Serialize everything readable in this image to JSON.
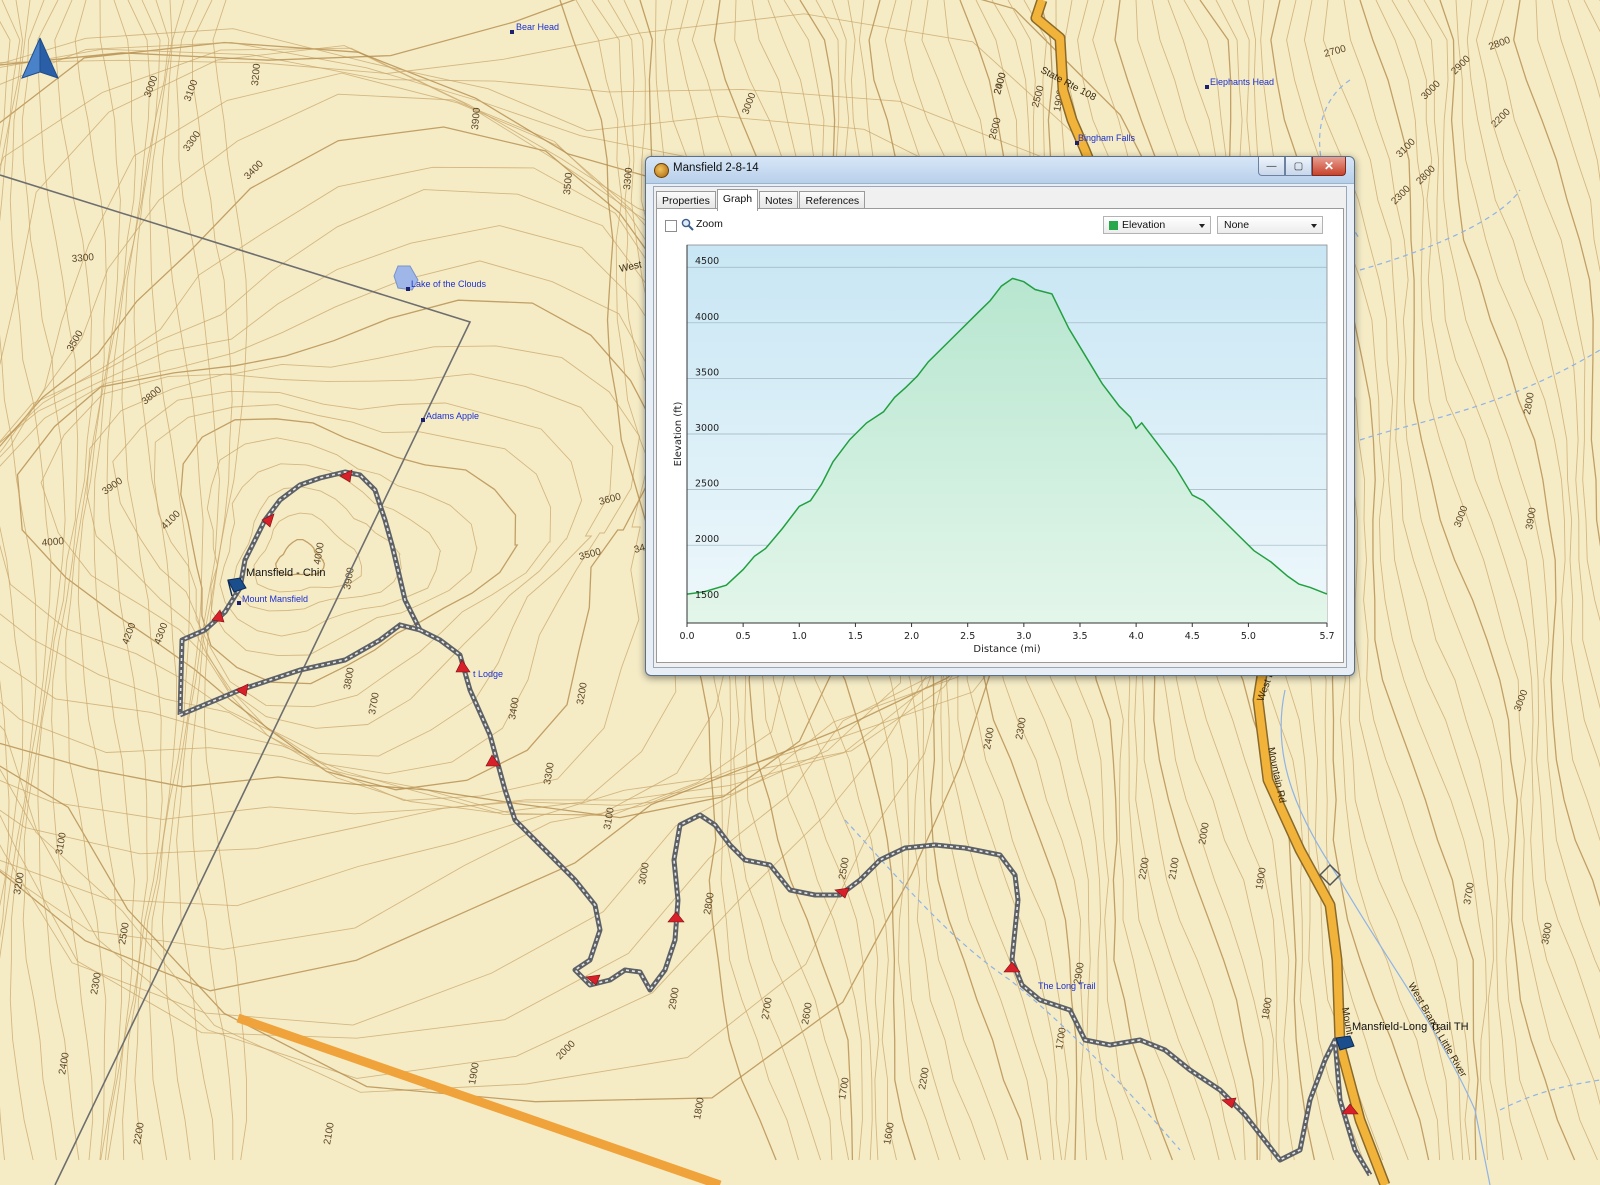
{
  "map": {
    "north_arrow_icon": "north-arrow-icon",
    "elevation_labels": [
      "3000",
      "3100",
      "3200",
      "3300",
      "3400",
      "3900",
      "3000",
      "3500",
      "3300",
      "3300",
      "3500",
      "3800",
      "3900",
      "4000",
      "4100",
      "4000",
      "4300",
      "4200",
      "3900",
      "3800",
      "3700",
      "3600",
      "3500",
      "3400",
      "3400",
      "3300",
      "3200",
      "3100",
      "3000",
      "2900",
      "2800",
      "2700",
      "2600",
      "2500",
      "2400",
      "2300",
      "2200",
      "2100",
      "2000",
      "1900",
      "1800",
      "1700",
      "3700",
      "3800",
      "3900",
      "3000",
      "2800",
      "2900",
      "3000",
      "3100",
      "3200",
      "2500",
      "2300",
      "2400",
      "2200",
      "2100",
      "2000",
      "1900",
      "1800",
      "1700",
      "1600",
      "2200",
      "2400",
      "2500",
      "2600",
      "2700",
      "2800",
      "2900",
      "3000",
      "3100",
      "2800",
      "2300",
      "2200",
      "2000",
      "1900"
    ],
    "poi": {
      "bear_head": "Bear Head",
      "elephants_head": "Elephants Head",
      "bingham_falls": "Bingham Falls",
      "lake_of_the_clouds": "Lake of the Clouds",
      "adams_apple": "Adams Apple",
      "mount_mansfield": "Mount Mansfield",
      "lodge": "t Lodge",
      "long_trail": "The Long Trail"
    },
    "roads": {
      "state_rte_108": "State Rte 108",
      "mountain_rd": "Mountain Rd",
      "west_branch": "West Branch Little River",
      "west": "West",
      "west_b": "West B",
      "mount": "Mount"
    },
    "waypoints": {
      "chin": "Mansfield - Chin",
      "trailhead": "Mansfield-Long Trail TH"
    },
    "colors": {
      "background": "#f5ecc6",
      "contour": "#c9a56a",
      "highway": "#f2b33a",
      "track": "#6f7378",
      "arrow": "#d8202a",
      "water": "#8fb3e6"
    }
  },
  "window": {
    "title": "Mansfield 2-8-14",
    "buttons": {
      "minimize": "—",
      "maximize": "▢",
      "close": "✕"
    },
    "tabs": [
      "Properties",
      "Graph",
      "Notes",
      "References"
    ],
    "active_tab": "Graph",
    "toolbar": {
      "zoom_label": "Zoom",
      "primary_select": "Elevation",
      "secondary_select": "None"
    }
  },
  "chart_data": {
    "type": "area",
    "title": "",
    "xlabel": "Distance  (mi)",
    "ylabel": "Elevation (ft)",
    "xlim": [
      0.0,
      5.7
    ],
    "ylim": [
      1300,
      4700
    ],
    "x_ticks": [
      "0.0",
      "0.5",
      "1.0",
      "1.5",
      "2.0",
      "2.5",
      "3.0",
      "3.5",
      "4.0",
      "4.5",
      "5.0",
      "5.7"
    ],
    "x_tick_values": [
      0.0,
      0.5,
      1.0,
      1.5,
      2.0,
      2.5,
      3.0,
      3.5,
      4.0,
      4.5,
      5.0,
      5.7
    ],
    "y_ticks": [
      "1500",
      "2000",
      "2500",
      "3000",
      "3500",
      "4000",
      "4500"
    ],
    "y_tick_values": [
      1500,
      2000,
      2500,
      3000,
      3500,
      4000,
      4500
    ],
    "line_color": "#22a040",
    "series": [
      {
        "x": [
          0.0,
          0.15,
          0.35,
          0.5,
          0.6,
          0.7,
          0.85,
          1.0,
          1.1,
          1.2,
          1.3,
          1.45,
          1.6,
          1.75,
          1.85,
          1.95,
          2.05,
          2.15,
          2.3,
          2.45,
          2.6,
          2.7,
          2.8,
          2.9,
          3.0,
          3.1,
          3.25,
          3.4,
          3.55,
          3.7,
          3.85,
          3.95,
          4.0,
          4.05,
          4.2,
          4.35,
          4.5,
          4.6,
          4.75,
          4.9,
          5.05,
          5.2,
          5.35,
          5.45,
          5.55,
          5.7
        ],
        "y": [
          1560,
          1580,
          1640,
          1780,
          1900,
          1970,
          2150,
          2350,
          2400,
          2550,
          2750,
          2950,
          3100,
          3200,
          3330,
          3420,
          3520,
          3650,
          3800,
          3950,
          4100,
          4200,
          4330,
          4400,
          4370,
          4300,
          4260,
          3950,
          3700,
          3450,
          3250,
          3150,
          3050,
          3100,
          2900,
          2700,
          2450,
          2400,
          2250,
          2100,
          1950,
          1850,
          1720,
          1650,
          1620,
          1560
        ]
      }
    ]
  }
}
